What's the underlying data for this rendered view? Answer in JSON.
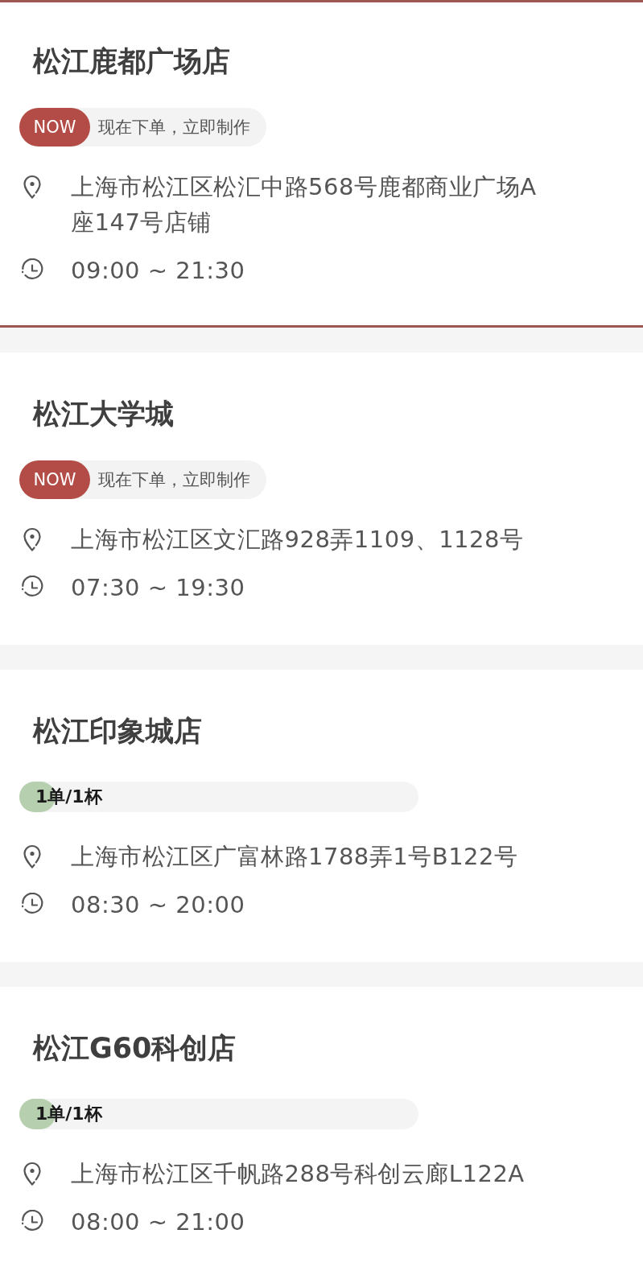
{
  "stores": [
    {
      "name": "松江鹿都广场店",
      "selected": true,
      "badge": {
        "kind": "now",
        "tag": "NOW",
        "text": "现在下单，立即制作"
      },
      "address": "上海市松江区松汇中路568号鹿都商业广场A座147号店铺",
      "hours": "09:00 ~ 21:30"
    },
    {
      "name": "松江大学城",
      "selected": false,
      "badge": {
        "kind": "now",
        "tag": "NOW",
        "text": "现在下单，立即制作"
      },
      "address": "上海市松江区文汇路928弄1109、1128号",
      "hours": "07:30 ~ 19:30"
    },
    {
      "name": "松江印象城店",
      "selected": false,
      "badge": {
        "kind": "progress",
        "text": "1单/1杯",
        "level": 0.09
      },
      "address": "上海市松江区广富林路1788弄1号B122号",
      "hours": "08:30 ~ 20:00"
    },
    {
      "name": "松江G60科创店",
      "selected": false,
      "badge": {
        "kind": "progress",
        "text": "1单/1杯",
        "level": 0.09
      },
      "address": "上海市松江区千帆路288号科创云廊L122A",
      "hours": "08:00 ~ 21:00"
    }
  ]
}
